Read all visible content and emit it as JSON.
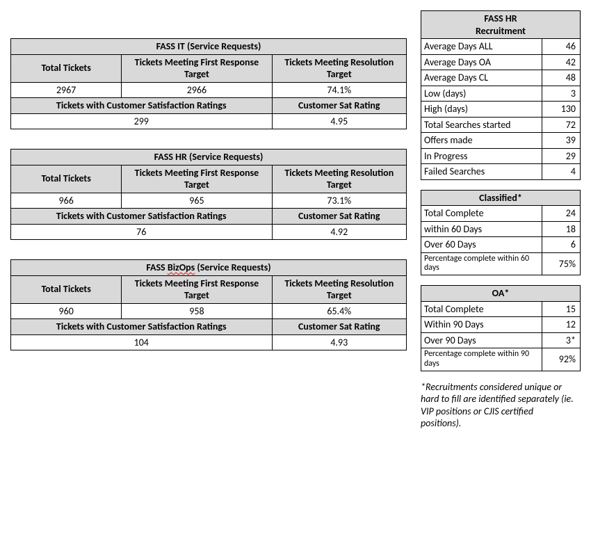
{
  "left_tables": [
    {
      "title": "FASS IT (Service Requests)",
      "squiggle": false,
      "col_labels": [
        "Total Tickets",
        "Tickets Meeting First Response Target",
        "Tickets Meeting Resolution Target"
      ],
      "row1": [
        "2967",
        "2966",
        "74.1%"
      ],
      "subhdr": [
        "Tickets with Customer Satisfaction Ratings",
        "Customer Sat Rating"
      ],
      "row2": [
        "299",
        "4.95"
      ]
    },
    {
      "title": "FASS HR (Service Requests)",
      "squiggle": false,
      "col_labels": [
        "Total Tickets",
        "Tickets Meeting First Response Target",
        "Tickets Meeting Resolution Target"
      ],
      "row1": [
        "966",
        "965",
        "73.1%"
      ],
      "subhdr": [
        "Tickets with Customer Satisfaction Ratings",
        "Customer Sat Rating"
      ],
      "row2": [
        "76",
        "4.92"
      ]
    },
    {
      "title": "FASS BizOps (Service Requests)",
      "squiggle": true,
      "col_labels": [
        "Total Tickets",
        "Tickets Meeting First Response Target",
        "Tickets Meeting Resolution Target"
      ],
      "row1": [
        "960",
        "958",
        "65.4%"
      ],
      "subhdr": [
        "Tickets with Customer Satisfaction Ratings",
        "Customer Sat Rating"
      ],
      "row2": [
        "104",
        "4.93"
      ]
    }
  ],
  "hr_recruitment": {
    "title_line1": "FASS HR",
    "title_line2": "Recruitment",
    "rows": [
      {
        "label": "Average Days ALL",
        "value": "46"
      },
      {
        "label": "Average  Days OA",
        "value": "42"
      },
      {
        "label": "Average Days CL",
        "value": "48"
      },
      {
        "label": "Low (days)",
        "value": "3"
      },
      {
        "label": "High (days)",
        "value": "130"
      },
      {
        "label": "Total Searches started",
        "value": "72"
      },
      {
        "label": "Offers made",
        "value": "39"
      },
      {
        "label": "In Progress",
        "value": "29"
      },
      {
        "label": "Failed Searches",
        "value": "4"
      }
    ]
  },
  "classified": {
    "title": "Classified*",
    "rows": [
      {
        "label": "Total Complete",
        "value": "24",
        "small": false
      },
      {
        "label": "within 60 Days",
        "value": "18",
        "small": false
      },
      {
        "label": "Over 60 Days",
        "value": "6",
        "small": false
      },
      {
        "label": "Percentage complete within 60 days",
        "value": "75%",
        "small": true
      }
    ]
  },
  "oa": {
    "title": "OA*",
    "rows": [
      {
        "label": "Total Complete",
        "value": "15",
        "small": false
      },
      {
        "label": "Within 90 Days",
        "value": "12",
        "small": false
      },
      {
        "label": "Over 90 Days",
        "value": "3*",
        "small": false
      },
      {
        "label": "Percentage complete within 90 days",
        "value": "92%",
        "small": true
      }
    ]
  },
  "footnote": "*Recruitments considered unique or hard to fill are identified separately (ie. VIP positions or CJIS certified positions)."
}
